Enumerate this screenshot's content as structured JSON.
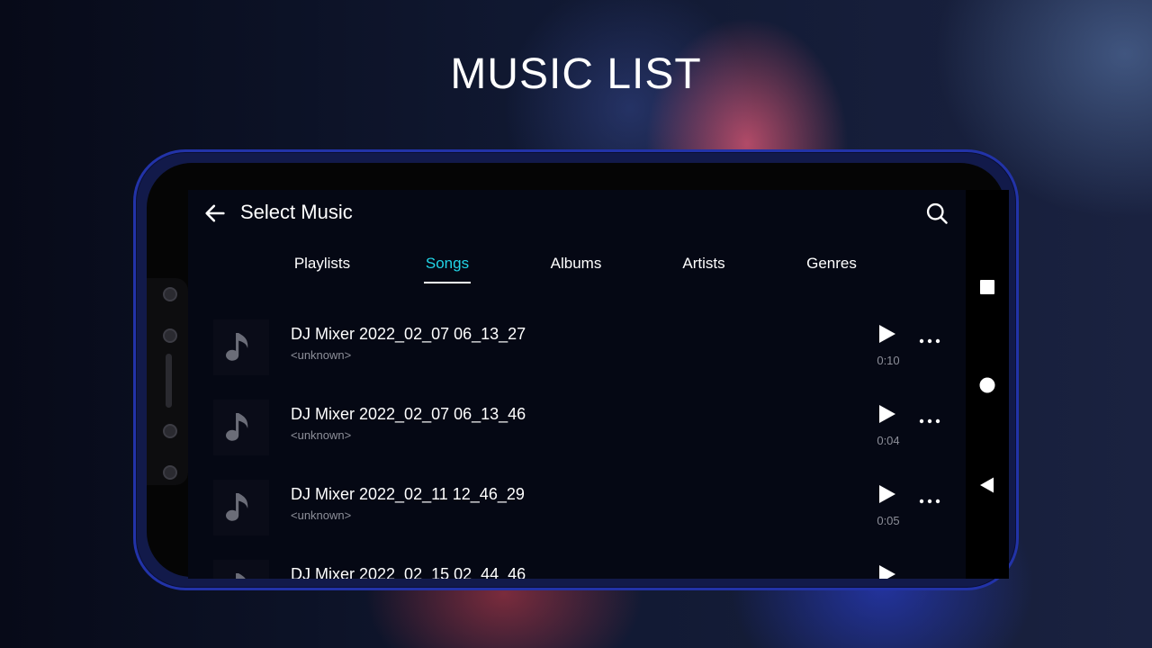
{
  "page": {
    "heading": "MUSIC LIST"
  },
  "appbar": {
    "title": "Select Music",
    "back_icon": "arrow-left-icon",
    "search_icon": "search-icon"
  },
  "tabs": [
    {
      "label": "Playlists",
      "active": false
    },
    {
      "label": "Songs",
      "active": true
    },
    {
      "label": "Albums",
      "active": false
    },
    {
      "label": "Artists",
      "active": false
    },
    {
      "label": "Genres",
      "active": false
    }
  ],
  "songs": [
    {
      "title": "DJ Mixer 2022_02_07 06_13_27",
      "artist": "<unknown>",
      "duration": "0:10"
    },
    {
      "title": "DJ Mixer 2022_02_07 06_13_46",
      "artist": "<unknown>",
      "duration": "0:04"
    },
    {
      "title": "DJ Mixer 2022_02_11 12_46_29",
      "artist": "<unknown>",
      "duration": "0:05"
    },
    {
      "title": "DJ Mixer 2022_02_15 02_44_46",
      "artist": "",
      "duration": ""
    }
  ],
  "system_nav": {
    "buttons": [
      "recents-square-icon",
      "home-circle-icon",
      "back-triangle-icon"
    ]
  },
  "colors": {
    "accent": "#21d4e6",
    "screen_bg": "#050814",
    "secondary_text": "#8d8f99"
  }
}
